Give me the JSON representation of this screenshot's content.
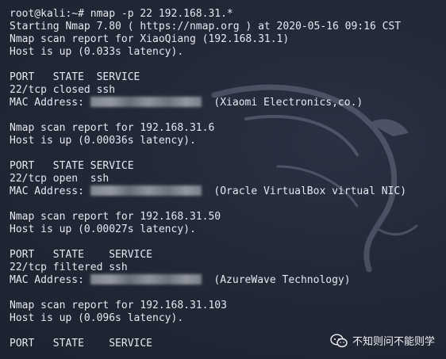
{
  "terminal": {
    "lines": [
      {
        "text": "root@kali:~# nmap -p 22 192.168.31.*"
      },
      {
        "text": "Starting Nmap 7.80 ( https://nmap.org ) at 2020-05-16 09:16 CST"
      },
      {
        "text": "Nmap scan report for XiaoQiang (192.168.31.1)"
      },
      {
        "text": "Host is up (0.033s latency)."
      },
      {
        "text": ""
      },
      {
        "text": "PORT   STATE  SERVICE"
      },
      {
        "text": "22/tcp closed ssh"
      },
      {
        "prefix": "MAC Address: ",
        "suffix": "  (Xiaomi Electronics,co.)"
      },
      {
        "text": ""
      },
      {
        "text": "Nmap scan report for 192.168.31.6"
      },
      {
        "text": "Host is up (0.00036s latency)."
      },
      {
        "text": ""
      },
      {
        "text": "PORT   STATE SERVICE"
      },
      {
        "text": "22/tcp open  ssh"
      },
      {
        "prefix": "MAC Address: ",
        "suffix": "  (Oracle VirtualBox virtual NIC)"
      },
      {
        "text": ""
      },
      {
        "text": "Nmap scan report for 192.168.31.50"
      },
      {
        "text": "Host is up (0.00027s latency)."
      },
      {
        "text": ""
      },
      {
        "text": "PORT   STATE    SERVICE"
      },
      {
        "text": "22/tcp filtered ssh"
      },
      {
        "prefix": "MAC Address: ",
        "suffix": "  (AzureWave Technology)"
      },
      {
        "text": ""
      },
      {
        "text": "Nmap scan report for 192.168.31.103"
      },
      {
        "text": "Host is up (0.096s latency)."
      },
      {
        "text": ""
      },
      {
        "text": "PORT   STATE    SERVICE"
      }
    ]
  },
  "watermark": {
    "text": "不知则问不能则学"
  },
  "colors": {
    "background": "#222837",
    "text": "#e6e8ee"
  }
}
